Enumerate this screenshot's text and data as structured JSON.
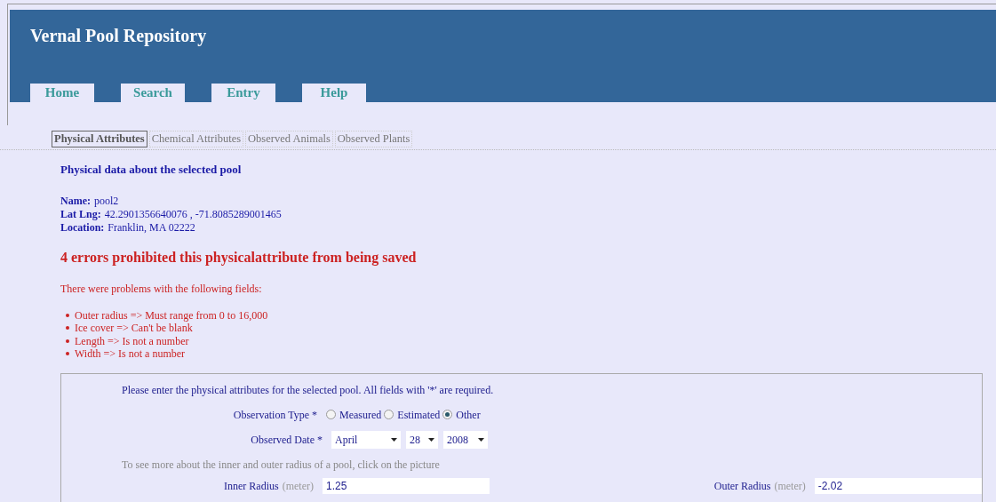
{
  "site_title": "Vernal Pool Repository",
  "nav": [
    "Home",
    "Search",
    "Entry",
    "Help"
  ],
  "tabs": [
    {
      "label": "Physical Attributes",
      "selected": true
    },
    {
      "label": "Chemical Attributes",
      "selected": false
    },
    {
      "label": "Observed Animals",
      "selected": false
    },
    {
      "label": "Observed Plants",
      "selected": false
    }
  ],
  "heading": "Physical data about the selected pool",
  "details": [
    {
      "label": "Name:",
      "value": "pool2"
    },
    {
      "label": "Lat Lng:",
      "value": "42.2901356640076 , -71.8085289001465"
    },
    {
      "label": "Location:",
      "value": "Franklin, MA 02222"
    }
  ],
  "errors": {
    "title": "4 errors prohibited this physicalattribute from being saved",
    "intro": "There were problems with the following fields:",
    "items": [
      "Outer radius => Must range from 0 to 16,000",
      "Ice cover => Can't be blank",
      "Length => Is not a number",
      "Width => Is not a number"
    ]
  },
  "form": {
    "instructions": "Please enter the physical attributes for the selected pool. All fields with '*' are required.",
    "observation_type": {
      "label": "Observation Type *",
      "options": [
        {
          "label": "Measured",
          "selected": false
        },
        {
          "label": "Estimated",
          "selected": false
        },
        {
          "label": "Other",
          "selected": true
        }
      ]
    },
    "observed_date": {
      "label": "Observed Date *",
      "month": "April",
      "day": "28",
      "year": "2008"
    },
    "radius_hint": "To see more about the inner and outer radius of a pool, click on the picture",
    "inner_radius": {
      "label": "Inner Radius",
      "unit": "(meter)",
      "value": "1.25"
    },
    "outer_radius": {
      "label": "Outer Radius",
      "unit": "(meter)",
      "value": "-2.02"
    }
  }
}
